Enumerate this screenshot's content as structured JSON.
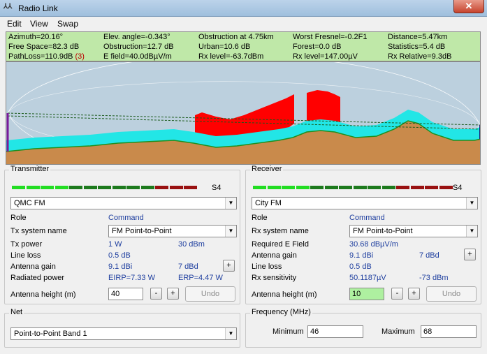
{
  "window": {
    "title": "Radio Link",
    "icon": "radio-mobile-icon",
    "close": "✕"
  },
  "menu": [
    "Edit",
    "View",
    "Swap"
  ],
  "info": {
    "row1": [
      "Azimuth=20.16°",
      "Elev. angle=-0.343°",
      "Obstruction at 4.75km",
      "Worst Fresnel=-0.2F1",
      "Distance=5.47km"
    ],
    "row2": [
      "Free Space=82.3 dB",
      "Obstruction=12.7 dB",
      "Urban=10.6 dB",
      "Forest=0.0 dB",
      "Statistics=5.4 dB"
    ],
    "row3_pathloss": "PathLoss=110.9dB",
    "row3_mode": "(3)",
    "row3": [
      "E field=40.0dBµV/m",
      "Rx level=-63.7dBm",
      "Rx level=147.00µV",
      "Rx Relative=9.3dB"
    ]
  },
  "colors": {
    "info_bg": "#bfe8a8",
    "terrain": "#c98a4b",
    "obstruction": "#ff0000",
    "fresnel_band": "#22e6e6",
    "sky": "#bcd0de",
    "meter_bright": "#22dd22",
    "meter_dark": "#1d7a1d",
    "meter_red": "#991111"
  },
  "transmitter": {
    "title": "Transmitter",
    "meter_label": "S4",
    "station": "QMC FM",
    "role_label": "Role",
    "role_value": "Command",
    "system_label": "Tx system name",
    "system_value": "FM Point-to-Point",
    "power_label": "Tx power",
    "power_w": "1 W",
    "power_dbm": "30 dBm",
    "loss_label": "Line loss",
    "loss_value": "0.5 dB",
    "gain_label": "Antenna gain",
    "gain_dbi": "9.1 dBi",
    "gain_dbd": "7 dBd",
    "radiated_label": "Radiated power",
    "eirp": "EIRP=7.33 W",
    "erp": "ERP=4.47 W",
    "height_label": "Antenna height (m)",
    "height_value": "40",
    "minus": "-",
    "plus": "+",
    "undo": "Undo",
    "gain_plus": "+"
  },
  "receiver": {
    "title": "Receiver",
    "meter_label": "S4",
    "station": "City FM",
    "role_label": "Role",
    "role_value": "Command",
    "system_label": "Rx system name",
    "system_value": "FM Point-to-Point",
    "efield_label": "Required E Field",
    "efield_value": "30.68 dBµV/m",
    "gain_label": "Antenna gain",
    "gain_dbi": "9.1 dBi",
    "gain_dbd": "7 dBd",
    "loss_label": "Line loss",
    "loss_value": "0.5 dB",
    "sens_label": "Rx sensitivity",
    "sens_uv": "50.1187µV",
    "sens_dbm": "-73 dBm",
    "height_label": "Antenna height (m)",
    "height_value": "10",
    "minus": "-",
    "plus": "+",
    "undo": "Undo",
    "gain_plus": "+"
  },
  "net": {
    "title": "Net",
    "value": "Point-to-Point Band 1"
  },
  "frequency": {
    "title": "Frequency (MHz)",
    "min_label": "Minimum",
    "min_value": "46",
    "max_label": "Maximum",
    "max_value": "68"
  },
  "meters": {
    "tx": [
      "bright",
      "bright",
      "bright",
      "bright",
      "dark",
      "dark",
      "dark",
      "dark",
      "dark",
      "dark",
      "red",
      "red",
      "red"
    ],
    "rx": [
      "bright",
      "bright",
      "bright",
      "bright",
      "dark",
      "dark",
      "dark",
      "dark",
      "dark",
      "dark",
      "red",
      "red",
      "red",
      "red"
    ]
  }
}
